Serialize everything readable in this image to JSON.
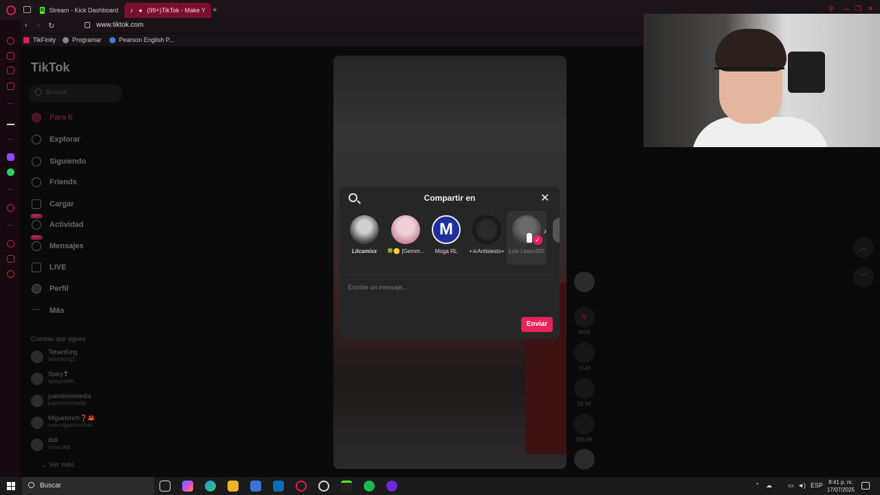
{
  "browser": {
    "tabs": [
      {
        "label": "Stream - Kick Dashboard"
      },
      {
        "label": "(99+)TikTok - Make Y"
      }
    ],
    "url": "www.tiktok.com",
    "bookmarks": [
      {
        "label": "TikFinity"
      },
      {
        "label": "Programar"
      },
      {
        "label": "Pearson English P..."
      }
    ]
  },
  "tiktok": {
    "logo": "TikTok",
    "search_placeholder": "Buscar",
    "nav": [
      {
        "label": "Para ti"
      },
      {
        "label": "Explorar"
      },
      {
        "label": "Siguiendo"
      },
      {
        "label": "Friends"
      },
      {
        "label": "Cargar"
      },
      {
        "label": "Actividad",
        "badge": "99+"
      },
      {
        "label": "Mensajes",
        "badge": "99+"
      },
      {
        "label": "LIVE"
      },
      {
        "label": "Perfil"
      },
      {
        "label": "Más"
      }
    ],
    "following_title": "Cuentas que sigues",
    "following": [
      {
        "name": "TebanKing",
        "handle": "tebanking1"
      },
      {
        "name": "Spicy❣",
        "handle": "spicycodm_"
      },
      {
        "name": "juansincomedia",
        "handle": "juansincomedia"
      },
      {
        "name": "Miguelonch❓🦀",
        "handle": "mdemiguelonchas"
      },
      {
        "name": "didi",
        "handle": "retsu.didi"
      }
    ],
    "see_more": "Ver más",
    "video_actions": {
      "likes": "465K",
      "comments": "1543",
      "saves": "29.8K",
      "shares": "588.8K"
    }
  },
  "share_dialog": {
    "title": "Compartir en",
    "contacts": [
      {
        "name": "Lilcamixx"
      },
      {
        "name": "🍀🟡 [Gemm..."
      },
      {
        "name": "Moga RL"
      },
      {
        "name": "+☠Antisiesto+"
      },
      {
        "name": "Luis Lasso300",
        "selected": true
      }
    ],
    "message_placeholder": "Escribe un mensaje...",
    "send_label": "Enviar",
    "colors": {
      "accent": "#e6245a",
      "bg": "#262626"
    }
  },
  "taskbar": {
    "search": "Buscar",
    "language": "ESP",
    "time": "8:41 p. m.",
    "date": "17/07/2025"
  }
}
